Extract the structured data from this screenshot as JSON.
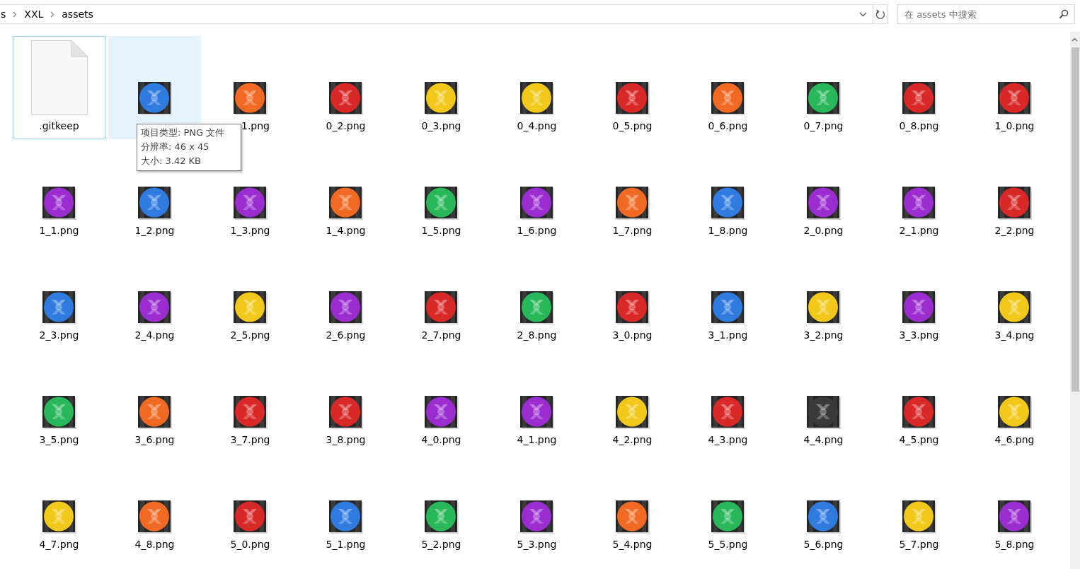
{
  "address_bar": {
    "crumbs": [
      "s",
      "XXL",
      "assets"
    ]
  },
  "search": {
    "placeholder": "在 assets 中搜索"
  },
  "files": [
    {
      "kind": "blank",
      "label": ".gitkeep",
      "focused": true,
      "hovered": false
    },
    {
      "kind": "image",
      "color": "#2f7be0",
      "focused": false,
      "hovered": true
    },
    {
      "kind": "image",
      "label": "1.png",
      "label_covered": true,
      "color": "#f06a24",
      "focused": false,
      "hovered": false
    },
    {
      "kind": "image",
      "label": "0_2.png",
      "color": "#d82828",
      "focused": false,
      "hovered": false
    },
    {
      "kind": "image",
      "label": "0_3.png",
      "color": "#f2c81a",
      "focused": false,
      "hovered": false
    },
    {
      "kind": "image",
      "label": "0_4.png",
      "color": "#f2c81a",
      "focused": false,
      "hovered": false
    },
    {
      "kind": "image",
      "label": "0_5.png",
      "color": "#d82828",
      "focused": false,
      "hovered": false
    },
    {
      "kind": "image",
      "label": "0_6.png",
      "color": "#f06a24",
      "focused": false,
      "hovered": false
    },
    {
      "kind": "image",
      "label": "0_7.png",
      "color": "#28b85a",
      "focused": false,
      "hovered": false
    },
    {
      "kind": "image",
      "label": "0_8.png",
      "color": "#d82828",
      "focused": false,
      "hovered": false
    },
    {
      "kind": "image",
      "label": "1_0.png",
      "color": "#d82828",
      "focused": false,
      "hovered": false
    },
    {
      "kind": "image",
      "label": "1_1.png",
      "color": "#9a2cd0",
      "focused": false,
      "hovered": false
    },
    {
      "kind": "image",
      "label": "1_2.png",
      "color": "#2f7be0",
      "focused": false,
      "hovered": false
    },
    {
      "kind": "image",
      "label": "1_3.png",
      "color": "#9a2cd0",
      "focused": false,
      "hovered": false
    },
    {
      "kind": "image",
      "label": "1_4.png",
      "color": "#f06a24",
      "focused": false,
      "hovered": false
    },
    {
      "kind": "image",
      "label": "1_5.png",
      "color": "#28b85a",
      "focused": false,
      "hovered": false
    },
    {
      "kind": "image",
      "label": "1_6.png",
      "color": "#9a2cd0",
      "focused": false,
      "hovered": false
    },
    {
      "kind": "image",
      "label": "1_7.png",
      "color": "#f06a24",
      "focused": false,
      "hovered": false
    },
    {
      "kind": "image",
      "label": "1_8.png",
      "color": "#2f7be0",
      "focused": false,
      "hovered": false
    },
    {
      "kind": "image",
      "label": "2_0.png",
      "color": "#9a2cd0",
      "focused": false,
      "hovered": false
    },
    {
      "kind": "image",
      "label": "2_1.png",
      "color": "#9a2cd0",
      "focused": false,
      "hovered": false
    },
    {
      "kind": "image",
      "label": "2_2.png",
      "color": "#d82828",
      "focused": false,
      "hovered": false
    },
    {
      "kind": "image",
      "label": "2_3.png",
      "color": "#2f7be0",
      "focused": false,
      "hovered": false
    },
    {
      "kind": "image",
      "label": "2_4.png",
      "color": "#9a2cd0",
      "focused": false,
      "hovered": false
    },
    {
      "kind": "image",
      "label": "2_5.png",
      "color": "#f2c81a",
      "focused": false,
      "hovered": false
    },
    {
      "kind": "image",
      "label": "2_6.png",
      "color": "#9a2cd0",
      "focused": false,
      "hovered": false
    },
    {
      "kind": "image",
      "label": "2_7.png",
      "color": "#d82828",
      "focused": false,
      "hovered": false
    },
    {
      "kind": "image",
      "label": "2_8.png",
      "color": "#28b85a",
      "focused": false,
      "hovered": false
    },
    {
      "kind": "image",
      "label": "3_0.png",
      "color": "#d82828",
      "focused": false,
      "hovered": false
    },
    {
      "kind": "image",
      "label": "3_1.png",
      "color": "#2f7be0",
      "focused": false,
      "hovered": false
    },
    {
      "kind": "image",
      "label": "3_2.png",
      "color": "#f2c81a",
      "focused": false,
      "hovered": false
    },
    {
      "kind": "image",
      "label": "3_3.png",
      "color": "#9a2cd0",
      "focused": false,
      "hovered": false
    },
    {
      "kind": "image",
      "label": "3_4.png",
      "color": "#f2c81a",
      "focused": false,
      "hovered": false
    },
    {
      "kind": "image",
      "label": "3_5.png",
      "color": "#28b85a",
      "focused": false,
      "hovered": false
    },
    {
      "kind": "image",
      "label": "3_6.png",
      "color": "#f06a24",
      "focused": false,
      "hovered": false
    },
    {
      "kind": "image",
      "label": "3_7.png",
      "color": "#d82828",
      "focused": false,
      "hovered": false
    },
    {
      "kind": "image",
      "label": "3_8.png",
      "color": "#d82828",
      "focused": false,
      "hovered": false
    },
    {
      "kind": "image",
      "label": "4_0.png",
      "color": "#9a2cd0",
      "focused": false,
      "hovered": false
    },
    {
      "kind": "image",
      "label": "4_1.png",
      "color": "#9a2cd0",
      "focused": false,
      "hovered": false
    },
    {
      "kind": "image",
      "label": "4_2.png",
      "color": "#f2c81a",
      "focused": false,
      "hovered": false
    },
    {
      "kind": "image",
      "label": "4_3.png",
      "color": "#d82828",
      "focused": false,
      "hovered": false
    },
    {
      "kind": "image",
      "label": "4_4.png",
      "color": "#3a3a3a",
      "focused": false,
      "hovered": false
    },
    {
      "kind": "image",
      "label": "4_5.png",
      "color": "#d82828",
      "focused": false,
      "hovered": false
    },
    {
      "kind": "image",
      "label": "4_6.png",
      "color": "#f2c81a",
      "focused": false,
      "hovered": false
    },
    {
      "kind": "image",
      "label": "4_7.png",
      "color": "#f2c81a",
      "focused": false,
      "hovered": false
    },
    {
      "kind": "image",
      "label": "4_8.png",
      "color": "#f06a24",
      "focused": false,
      "hovered": false
    },
    {
      "kind": "image",
      "label": "5_0.png",
      "color": "#d82828",
      "focused": false,
      "hovered": false
    },
    {
      "kind": "image",
      "label": "5_1.png",
      "color": "#2f7be0",
      "focused": false,
      "hovered": false
    },
    {
      "kind": "image",
      "label": "5_2.png",
      "color": "#28b85a",
      "focused": false,
      "hovered": false
    },
    {
      "kind": "image",
      "label": "5_3.png",
      "color": "#9a2cd0",
      "focused": false,
      "hovered": false
    },
    {
      "kind": "image",
      "label": "5_4.png",
      "color": "#f06a24",
      "focused": false,
      "hovered": false
    },
    {
      "kind": "image",
      "label": "5_5.png",
      "color": "#28b85a",
      "focused": false,
      "hovered": false
    },
    {
      "kind": "image",
      "label": "5_6.png",
      "color": "#2f7be0",
      "focused": false,
      "hovered": false
    },
    {
      "kind": "image",
      "label": "5_7.png",
      "color": "#f2c81a",
      "focused": false,
      "hovered": false
    },
    {
      "kind": "image",
      "label": "5_8.png",
      "color": "#9a2cd0",
      "focused": false,
      "hovered": false
    }
  ],
  "tooltip": {
    "lines": [
      "项目类型: PNG 文件",
      "分辨率: 46 x 45",
      "大小: 3.42 KB"
    ]
  }
}
